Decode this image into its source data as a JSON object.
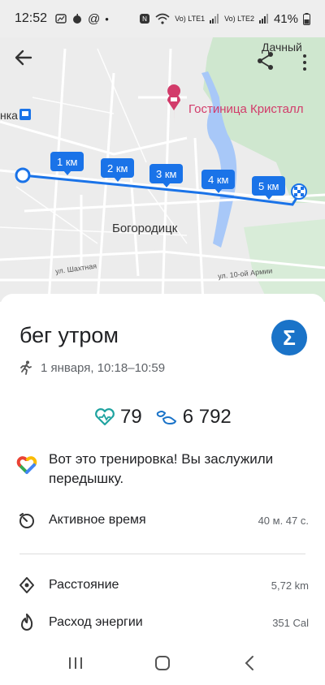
{
  "status": {
    "time": "12:52",
    "signal1": "Vo) LTE1",
    "signal2": "Vo) LTE2",
    "battery": "41%"
  },
  "map": {
    "top_right_label": "Дачный",
    "left_label": "нка",
    "poi": "Гостиница Кристалл",
    "town": "Богородицк",
    "street1": "ул. Шахтная",
    "street2": "ул. 10-ой Армии",
    "markers": [
      "1 км",
      "2 км",
      "3 км",
      "4 км",
      "5 км"
    ]
  },
  "workout": {
    "title": "бег утром",
    "date": "1 января, 10:18–10:59",
    "heart_points": "79",
    "steps": "6 792",
    "message": "Вот это тренировка! Вы заслужили передышку.",
    "active_time_label": "Активное время",
    "active_time_value": "40 м. 47 с.",
    "distance_label": "Расстояние",
    "distance_value": "5,72 km",
    "energy_label": "Расход энергии",
    "energy_value": "351 Cal"
  },
  "icons": {
    "back": "arrow-left-icon",
    "share": "share-icon",
    "more": "more-vert-icon",
    "sigma": "sigma-icon",
    "run": "run-icon",
    "heart": "heart-points-icon",
    "steps": "steps-icon",
    "fit": "google-fit-icon",
    "timer": "timer-icon",
    "distance": "location-icon",
    "energy": "flame-icon"
  },
  "colors": {
    "route": "#1a73e8",
    "accent": "#1a73c8",
    "heart": "#1fa3a0",
    "poi": "#d23b6a",
    "park": "#cfe7cf",
    "water": "#a8c8f8"
  }
}
